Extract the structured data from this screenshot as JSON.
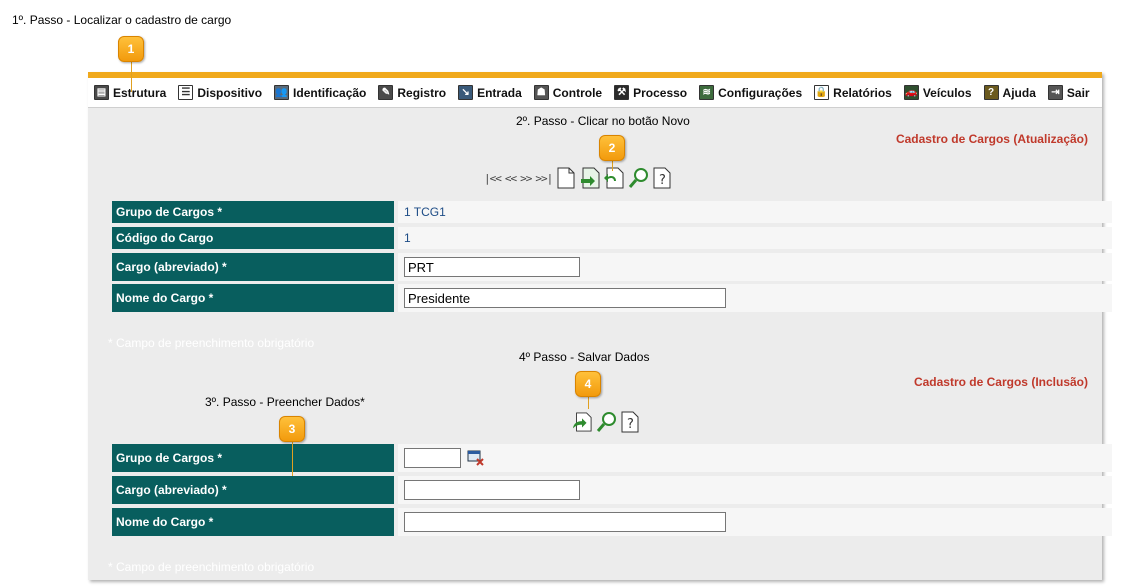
{
  "step1_caption": "1º. Passo - Localizar o cadastro de cargo",
  "callouts": [
    "1",
    "2",
    "3",
    "4"
  ],
  "menu": [
    {
      "label": "Estrutura",
      "icon": "structure-icon"
    },
    {
      "label": "Dispositivo",
      "icon": "device-icon"
    },
    {
      "label": "Identificação",
      "icon": "identification-icon"
    },
    {
      "label": "Registro",
      "icon": "registry-icon"
    },
    {
      "label": "Entrada",
      "icon": "entry-icon"
    },
    {
      "label": "Controle",
      "icon": "control-icon"
    },
    {
      "label": "Processo",
      "icon": "process-icon"
    },
    {
      "label": "Configurações",
      "icon": "settings-icon"
    },
    {
      "label": "Relatórios",
      "icon": "reports-icon"
    },
    {
      "label": "Veículos",
      "icon": "vehicle-icon"
    },
    {
      "label": "Ajuda",
      "icon": "help-icon"
    },
    {
      "label": "Sair",
      "icon": "exit-icon"
    }
  ],
  "update_section": {
    "step_caption": "2º. Passo - Clicar no botão Novo",
    "title": "Cadastro de Cargos (Atualização)",
    "nav_first": "|<<",
    "nav_prev": "<<",
    "nav_next": ">>",
    "nav_last": ">>|",
    "fields": {
      "grupo_label": "Grupo de Cargos *",
      "grupo_value": "1 TCG1",
      "codigo_label": "Código do Cargo",
      "codigo_value": "1",
      "abreviado_label": "Cargo (abreviado) *",
      "abreviado_value": "PRT",
      "nome_label": "Nome do Cargo *",
      "nome_value": "Presidente"
    },
    "required_note": "* Campo de preenchimento obrigatório"
  },
  "insert_section": {
    "step4_caption": "4º Passo - Salvar Dados",
    "step3_caption": "3º. Passo - Preencher Dados*",
    "title": "Cadastro de Cargos (Inclusão)",
    "fields": {
      "grupo_label": "Grupo de Cargos *",
      "grupo_value": "",
      "abreviado_label": "Cargo (abreviado) *",
      "abreviado_value": "",
      "nome_label": "Nome do Cargo *",
      "nome_value": ""
    },
    "required_note": "* Campo de preenchimento obrigatório"
  },
  "colors": {
    "label_bg": "#085e5e",
    "title_red": "#c0392b",
    "accent_orange": "#f0a91c",
    "value_blue": "#1d4c86"
  }
}
